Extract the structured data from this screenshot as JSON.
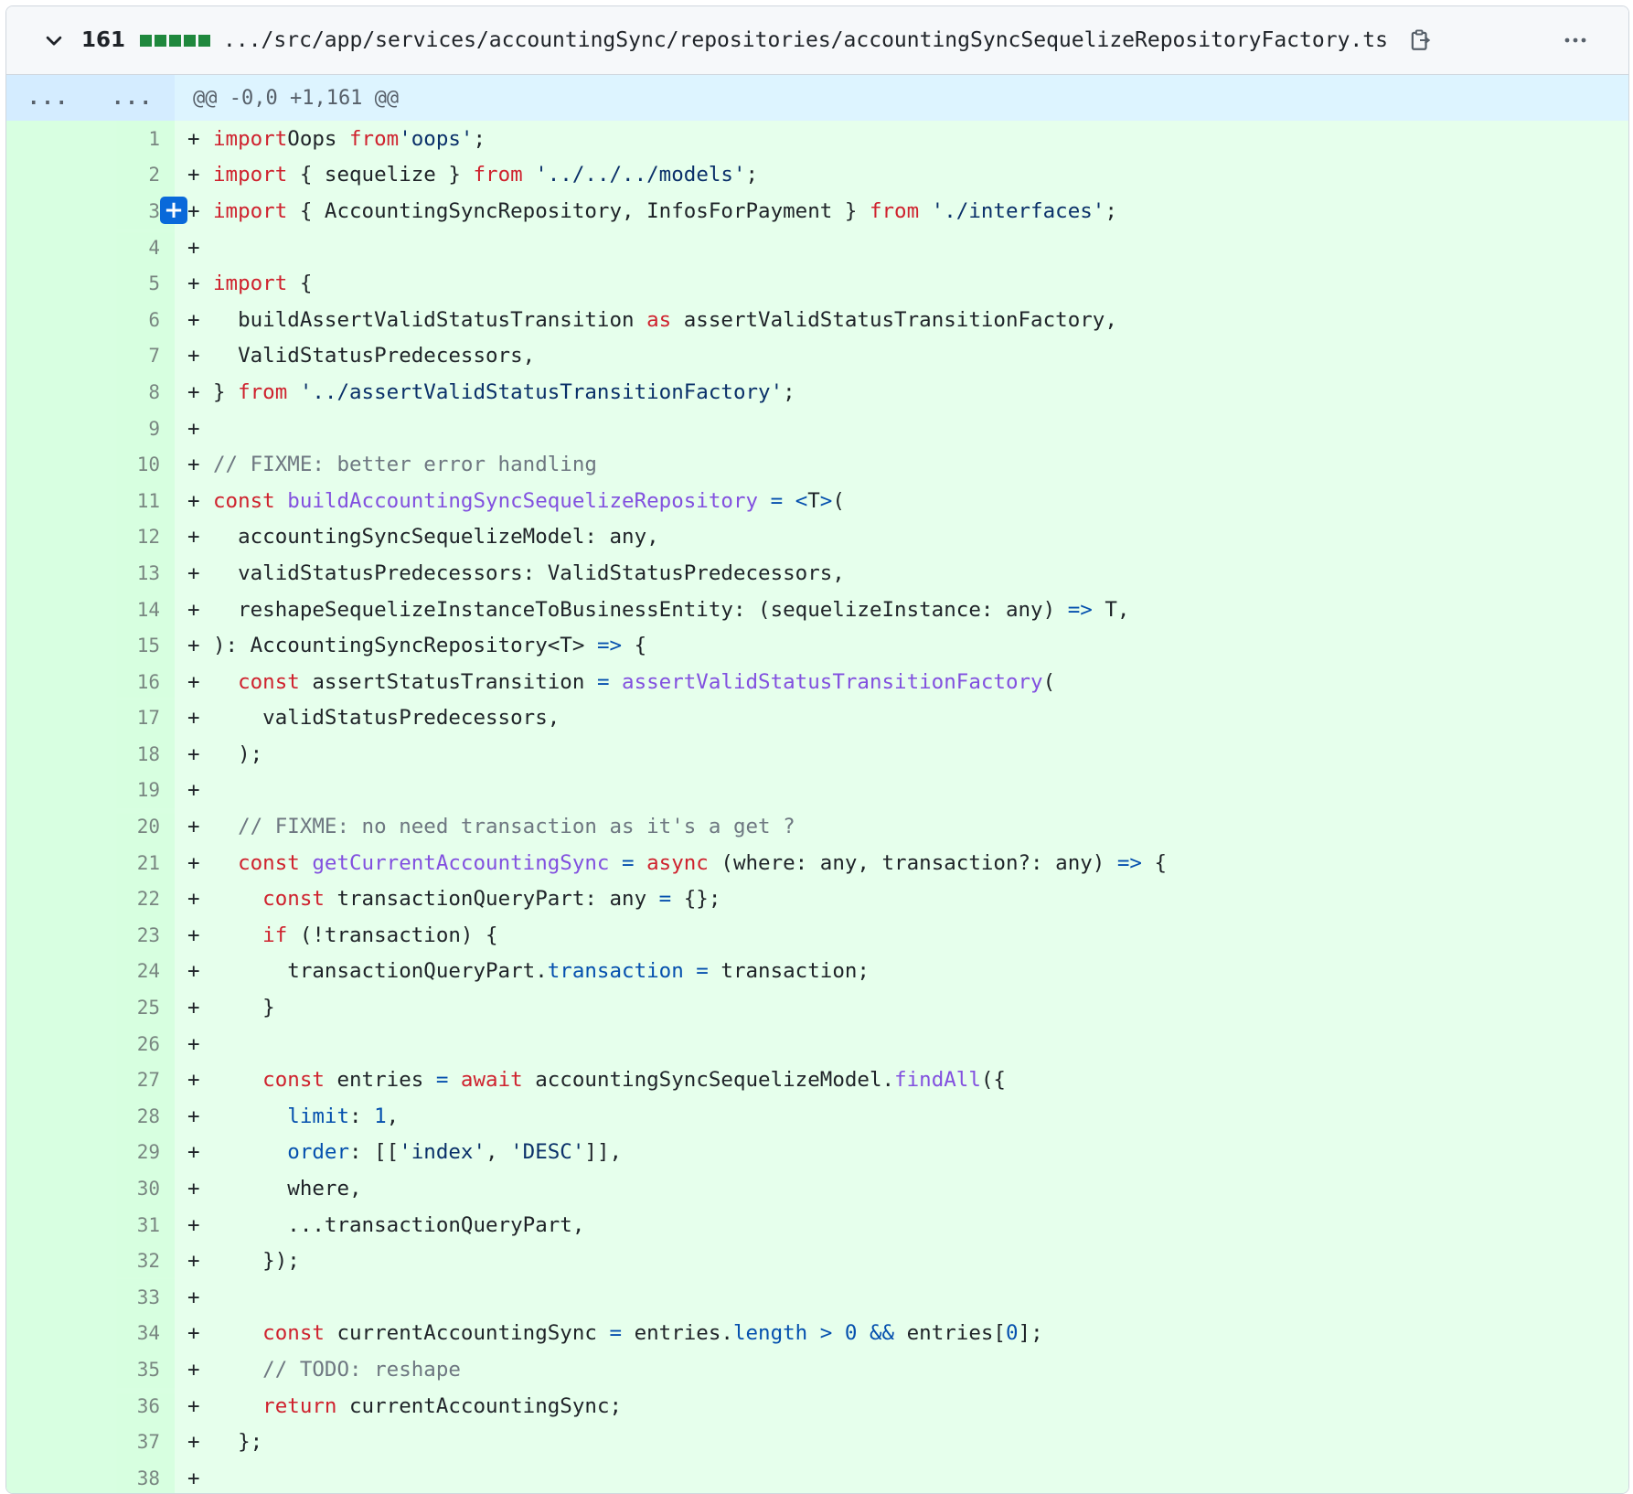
{
  "file": {
    "changes": "161",
    "path": ".../src/app/services/accountingSync/repositories/accountingSyncSequelizeRepositoryFactory.ts",
    "hunk": {
      "left_expander": "...",
      "right_expander": "...",
      "header": "@@ -0,0 +1,161 @@"
    },
    "add_comment_label": "+",
    "colors": {
      "added_bg": "#e6ffec",
      "added_gutter": "#ccffd8",
      "hunk_bg": "#ddf4ff",
      "keyword": "#cf222e",
      "string": "#0a3069",
      "function": "#8250df",
      "comment": "#6e7781",
      "property": "#0550ae",
      "diffstat": "#1f883d"
    },
    "icons": [
      "chevron-down-icon",
      "copy-icon",
      "kebab-menu-icon"
    ],
    "lines": [
      {
        "n": "1",
        "t": [
          [
            "k",
            "import"
          ],
          [
            "",
            "Oops",
            " "
          ],
          [
            "k",
            "from"
          ],
          [
            "s",
            "'oops'"
          ],
          [
            "",
            ";"
          ]
        ]
      },
      {
        "n": "2",
        "t": [
          [
            "k",
            "import"
          ],
          [
            "",
            " { sequelize } "
          ],
          [
            "k",
            "from"
          ],
          [
            "s",
            " '../../../models'"
          ],
          [
            "",
            ";"
          ]
        ]
      },
      {
        "n": "3",
        "t": [
          [
            "k",
            "import"
          ],
          [
            "",
            " { AccountingSyncRepository, InfosForPayment } "
          ],
          [
            "k",
            "from"
          ],
          [
            "s",
            " './interfaces'"
          ],
          [
            "",
            ";"
          ]
        ]
      },
      {
        "n": "4",
        "t": []
      },
      {
        "n": "5",
        "t": [
          [
            "k",
            "import"
          ],
          [
            "",
            " {"
          ]
        ]
      },
      {
        "n": "6",
        "t": [
          [
            "",
            "  buildAssertValidStatusTransition "
          ],
          [
            "k",
            "as"
          ],
          [
            "",
            " assertValidStatusTransitionFactory,"
          ]
        ]
      },
      {
        "n": "7",
        "t": [
          [
            "",
            "  ValidStatusPredecessors,"
          ]
        ]
      },
      {
        "n": "8",
        "t": [
          [
            "",
            "} "
          ],
          [
            "k",
            "from"
          ],
          [
            "s",
            " '../assertValidStatusTransitionFactory'"
          ],
          [
            "",
            ";"
          ]
        ]
      },
      {
        "n": "9",
        "t": []
      },
      {
        "n": "10",
        "t": [
          [
            "c",
            "// FIXME: better error handling"
          ]
        ]
      },
      {
        "n": "11",
        "t": [
          [
            "k",
            "const"
          ],
          [
            "f",
            " buildAccountingSyncSequelizeRepository"
          ],
          [
            "p",
            " ="
          ],
          [
            "",
            " "
          ],
          [
            "p",
            "<"
          ],
          [
            "",
            "T"
          ],
          [
            "p",
            ">"
          ],
          [
            "",
            "("
          ]
        ]
      },
      {
        "n": "12",
        "t": [
          [
            "",
            "  accountingSyncSequelizeModel: any,"
          ]
        ]
      },
      {
        "n": "13",
        "t": [
          [
            "",
            "  validStatusPredecessors: ValidStatusPredecessors,"
          ]
        ]
      },
      {
        "n": "14",
        "t": [
          [
            "",
            "  reshapeSequelizeInstanceToBusinessEntity: (sequelizeInstance: any) "
          ],
          [
            "p",
            "=>"
          ],
          [
            "",
            " T,"
          ]
        ]
      },
      {
        "n": "15",
        "t": [
          [
            "",
            "): AccountingSyncRepository<T> "
          ],
          [
            "p",
            "=>"
          ],
          [
            "",
            " {"
          ]
        ]
      },
      {
        "n": "16",
        "t": [
          [
            "k",
            "  const"
          ],
          [
            "",
            " assertStatusTransition "
          ],
          [
            "p",
            "="
          ],
          [
            "f",
            " assertValidStatusTransitionFactory"
          ],
          [
            "",
            "("
          ]
        ]
      },
      {
        "n": "17",
        "t": [
          [
            "",
            "    validStatusPredecessors,"
          ]
        ]
      },
      {
        "n": "18",
        "t": [
          [
            "",
            "  );"
          ]
        ]
      },
      {
        "n": "19",
        "t": []
      },
      {
        "n": "20",
        "t": [
          [
            "c",
            "  // FIXME: no need transaction as it's a get ?"
          ]
        ]
      },
      {
        "n": "21",
        "t": [
          [
            "k",
            "  const"
          ],
          [
            "f",
            " getCurrentAccountingSync"
          ],
          [
            "p",
            " ="
          ],
          [
            "k",
            " async"
          ],
          [
            "",
            " (where: any, transaction?: any) "
          ],
          [
            "p",
            "=>"
          ],
          [
            "",
            " {"
          ]
        ]
      },
      {
        "n": "22",
        "t": [
          [
            "k",
            "    const"
          ],
          [
            "",
            " transactionQueryPart: any "
          ],
          [
            "p",
            "="
          ],
          [
            "",
            " {};"
          ]
        ]
      },
      {
        "n": "23",
        "t": [
          [
            "k",
            "    if"
          ],
          [
            "",
            " (!transaction) {"
          ]
        ]
      },
      {
        "n": "24",
        "t": [
          [
            "",
            "      transactionQueryPart."
          ],
          [
            "p",
            "transaction"
          ],
          [
            "p",
            " ="
          ],
          [
            "",
            " transaction;"
          ]
        ]
      },
      {
        "n": "25",
        "t": [
          [
            "",
            "    }"
          ]
        ]
      },
      {
        "n": "26",
        "t": []
      },
      {
        "n": "27",
        "t": [
          [
            "k",
            "    const"
          ],
          [
            "",
            " entries "
          ],
          [
            "p",
            "="
          ],
          [
            "k",
            " await"
          ],
          [
            "",
            " accountingSyncSequelizeModel."
          ],
          [
            "f",
            "findAll"
          ],
          [
            "",
            "({"
          ]
        ]
      },
      {
        "n": "28",
        "t": [
          [
            "p",
            "      limit"
          ],
          [
            "",
            ": "
          ],
          [
            "p",
            "1"
          ],
          [
            "",
            ","
          ]
        ]
      },
      {
        "n": "29",
        "t": [
          [
            "p",
            "      order"
          ],
          [
            "",
            ": [["
          ],
          [
            "s",
            "'index'"
          ],
          [
            "",
            ", "
          ],
          [
            "s",
            "'DESC'"
          ],
          [
            "",
            "]],"
          ]
        ]
      },
      {
        "n": "30",
        "t": [
          [
            "",
            "      where,"
          ]
        ]
      },
      {
        "n": "31",
        "t": [
          [
            "",
            "      ...transactionQueryPart,"
          ]
        ]
      },
      {
        "n": "32",
        "t": [
          [
            "",
            "    });"
          ]
        ]
      },
      {
        "n": "33",
        "t": []
      },
      {
        "n": "34",
        "t": [
          [
            "k",
            "    const"
          ],
          [
            "",
            " currentAccountingSync "
          ],
          [
            "p",
            "="
          ],
          [
            "",
            " entries."
          ],
          [
            "p",
            "length"
          ],
          [
            "p",
            " >"
          ],
          [
            "p",
            " 0"
          ],
          [
            "p",
            " &&"
          ],
          [
            "",
            " entries["
          ],
          [
            "p",
            "0"
          ],
          [
            "",
            "];"
          ]
        ]
      },
      {
        "n": "35",
        "t": [
          [
            "c",
            "    // TODO: reshape"
          ]
        ]
      },
      {
        "n": "36",
        "t": [
          [
            "k",
            "    return"
          ],
          [
            "",
            " currentAccountingSync;"
          ]
        ]
      },
      {
        "n": "37",
        "t": [
          [
            "",
            "  };"
          ]
        ]
      },
      {
        "n": "38",
        "t": []
      }
    ]
  }
}
